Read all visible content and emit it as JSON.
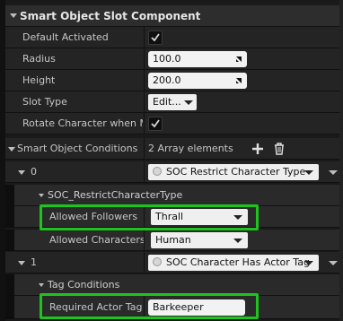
{
  "component": {
    "title": "Smart Object Slot Component"
  },
  "properties": {
    "default_activated": {
      "label": "Default Activated",
      "checked": true
    },
    "radius": {
      "label": "Radius",
      "value": "100.0"
    },
    "height": {
      "label": "Height",
      "value": "200.0"
    },
    "slot_type": {
      "label": "Slot Type",
      "value": "Edit..."
    },
    "rotate_character": {
      "label": "Rotate Character when Mo",
      "checked": true
    },
    "smart_object_conditions": {
      "label": "Smart Object Conditions",
      "count_text": "2 Array elements"
    }
  },
  "elements": [
    {
      "index_label": "0",
      "type_value": "SOC Restrict Character Type",
      "section_title": "SOC_RestrictCharacterType",
      "fields": [
        {
          "label": "Allowed Followers",
          "value": "Thrall"
        },
        {
          "label": "Allowed Characters",
          "value": "Human"
        }
      ]
    },
    {
      "index_label": "1",
      "type_value": "SOC Character Has Actor Tag",
      "section_title": "Tag Conditions",
      "fields": [
        {
          "label": "Required Actor Tag",
          "value": "Barkeeper"
        }
      ]
    }
  ],
  "colors": {
    "highlight": "#1ec41e",
    "panel_bg": "#242424",
    "field_bg": "#f2f2f2"
  },
  "icons": {
    "expand": "triangle-down-icon",
    "add": "plus-icon",
    "delete": "trash-icon",
    "resize": "resize-handle-icon",
    "class": "class-circle-icon"
  }
}
